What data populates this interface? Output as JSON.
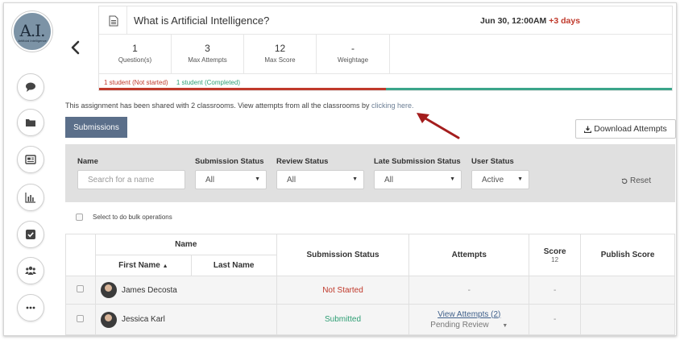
{
  "logo": {
    "text": "A.I.",
    "subtext": "Artificial Intelligence"
  },
  "rail": {
    "items": [
      {
        "icon": "chat-icon"
      },
      {
        "icon": "folder-icon"
      },
      {
        "icon": "assignment-icon"
      },
      {
        "icon": "bar-chart-icon"
      },
      {
        "icon": "checkbox-icon"
      },
      {
        "icon": "users-icon"
      },
      {
        "icon": "more-icon"
      }
    ]
  },
  "assignment": {
    "title": "What is Artificial Intelligence?",
    "due": "Jun 30, 12:00AM",
    "late": "+3 days",
    "stats": [
      {
        "value": "1",
        "label": "Question(s)"
      },
      {
        "value": "3",
        "label": "Max Attempts"
      },
      {
        "value": "12",
        "label": "Max Score"
      },
      {
        "value": "-",
        "label": "Weightage"
      }
    ],
    "status_not_started": "1 student (Not started)",
    "status_completed": "1 student (Completed)",
    "progress_not_started_fraction": 0.5
  },
  "shared": {
    "text": "This assignment has been shared with 2 classrooms. View attempts from all the classrooms by",
    "link": "clicking here."
  },
  "tabs": {
    "submissions": "Submissions"
  },
  "download_label": "Download Attempts",
  "filters": {
    "name_label": "Name",
    "name_placeholder": "Search for a name",
    "submission_status_label": "Submission Status",
    "submission_status_value": "All",
    "review_status_label": "Review Status",
    "review_status_value": "All",
    "late_submission_label": "Late Submission Status",
    "late_submission_value": "All",
    "user_status_label": "User Status",
    "user_status_value": "Active",
    "reset_label": "Reset"
  },
  "bulk_label": "Select to do bulk operations",
  "table": {
    "headers": {
      "name": "Name",
      "first_name": "First Name",
      "last_name": "Last Name",
      "submission_status": "Submission Status",
      "attempts": "Attempts",
      "score": "Score",
      "score_max": "12",
      "publish_score": "Publish Score"
    },
    "rows": [
      {
        "name": "James Decosta",
        "status": "Not Started",
        "attempts": "-",
        "score": "-"
      },
      {
        "name": "Jessica Karl",
        "status": "Submitted",
        "attempts_link": "View Attempts (2)",
        "review": "Pending Review",
        "score": "-"
      }
    ]
  },
  "colors": {
    "accent": "#5b6f8a",
    "not_started": "#c0392b",
    "completed": "#2e9e74"
  }
}
